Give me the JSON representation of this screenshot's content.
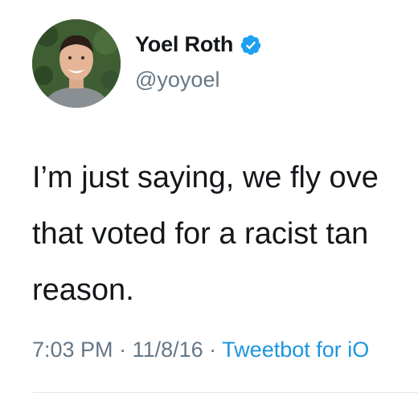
{
  "author": {
    "display_name": "Yoel Roth",
    "handle": "@yoyoel",
    "verified": true,
    "avatar_icon": "profile-photo"
  },
  "tweet": {
    "lines": [
      "I’m just saying, we fly ove",
      "that voted for a racist tan",
      "reason."
    ]
  },
  "meta": {
    "time": "7:03 PM",
    "separator": " · ",
    "date": "11/8/16",
    "source": "Tweetbot for iO"
  },
  "colors": {
    "verified_badge": "#1da1f2",
    "link": "#1b95e0",
    "secondary_text": "#657786",
    "primary_text": "#14171a"
  }
}
